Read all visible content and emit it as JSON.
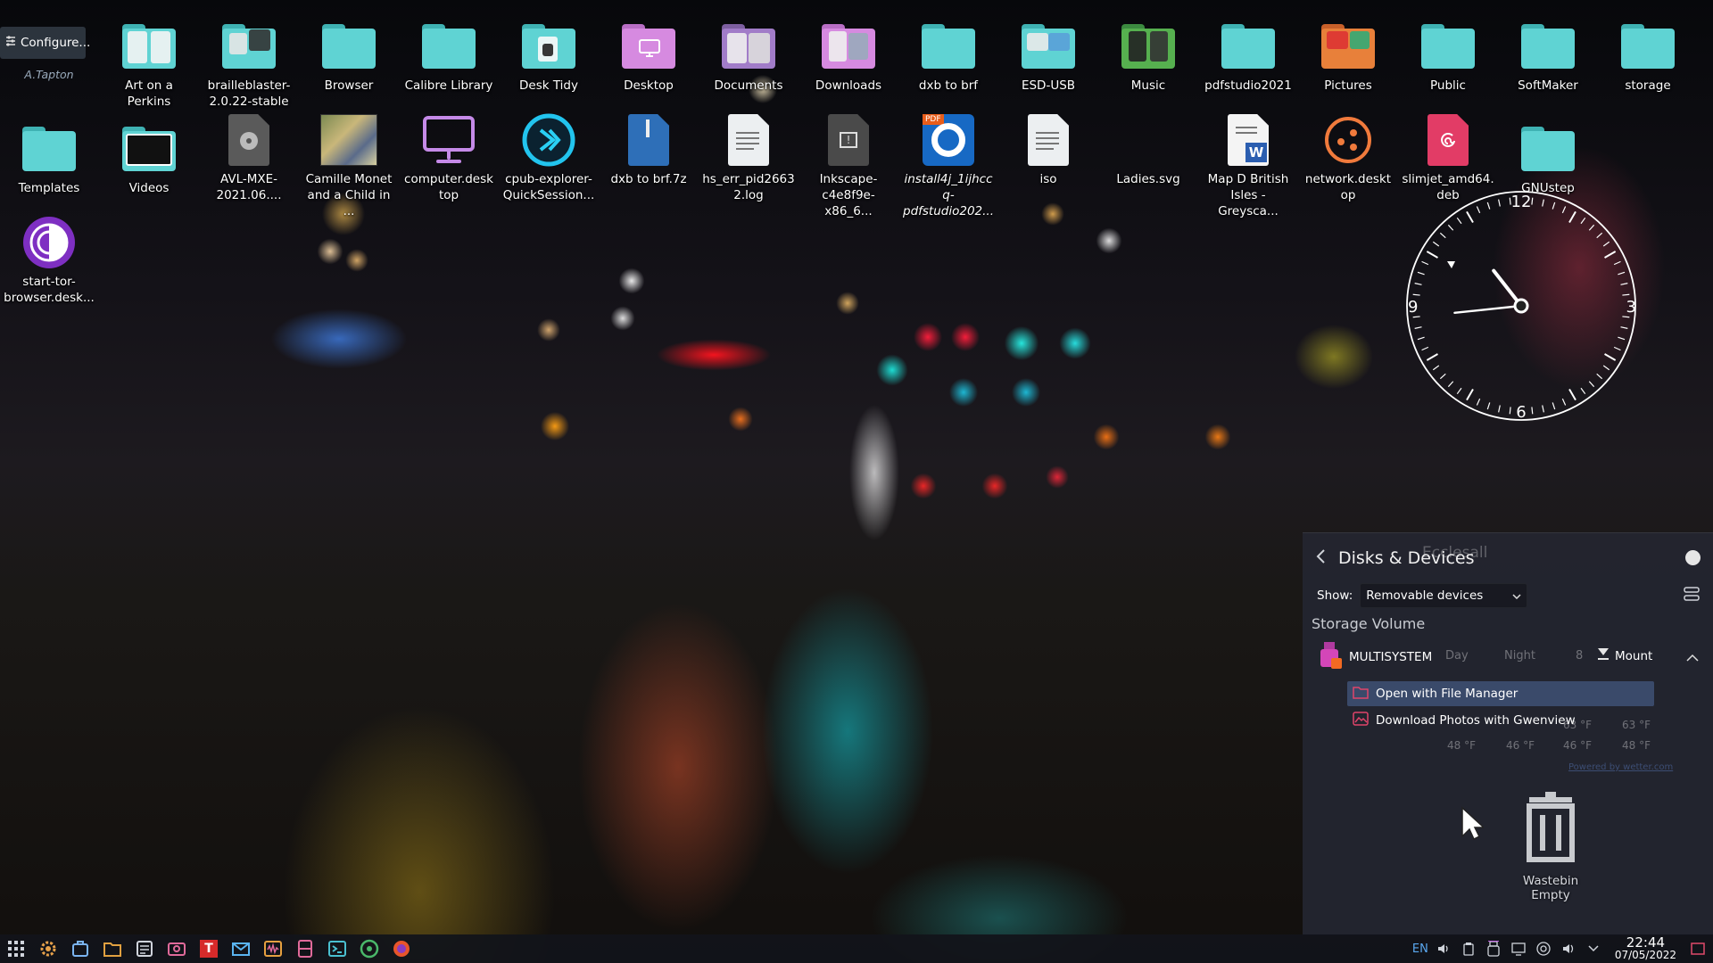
{
  "desktop": {
    "configure": {
      "label": "Configure...",
      "sub": "A.Tapton"
    },
    "icons": [
      {
        "label": "Art on a Perkins"
      },
      {
        "label": "brailleblaster-2.0.22-stable"
      },
      {
        "label": "Browser"
      },
      {
        "label": "Calibre Library"
      },
      {
        "label": "Desk Tidy"
      },
      {
        "label": "Desktop"
      },
      {
        "label": "Documents"
      },
      {
        "label": "Downloads"
      },
      {
        "label": "dxb to brf"
      },
      {
        "label": "ESD-USB"
      },
      {
        "label": "Music"
      },
      {
        "label": "pdfstudio2021"
      },
      {
        "label": "Pictures"
      },
      {
        "label": "Public"
      },
      {
        "label": "SoftMaker"
      },
      {
        "label": "storage"
      },
      {
        "label": "Templates"
      },
      {
        "label": "Videos"
      },
      {
        "label": "AVL-MXE-2021.06...."
      },
      {
        "label": "Camille Monet and a Child in ..."
      },
      {
        "label": "computer.desktop"
      },
      {
        "label": "cpub-explorer-QuickSession..."
      },
      {
        "label": "dxb to brf.7z"
      },
      {
        "label": "hs_err_pid26632.log"
      },
      {
        "label": "Inkscape-c4e8f9e-x86_6..."
      },
      {
        "label": "install4j_1ijhccq-pdfstudio202..."
      },
      {
        "label": "iso"
      },
      {
        "label": "Ladies.svg"
      },
      {
        "label": "Map D British Isles - Greysca..."
      },
      {
        "label": "network.desktop"
      },
      {
        "label": "slimjet_amd64.deb"
      },
      {
        "label": "GNUstep"
      },
      {
        "label": "start-tor-browser.desk..."
      }
    ]
  },
  "clock": {
    "numerals": [
      "12",
      "3",
      "6",
      "9"
    ],
    "time": "22:44"
  },
  "disks_panel": {
    "title": "Disks & Devices",
    "show_label": "Show:",
    "show_value": "Removable devices",
    "section": "Storage Volume",
    "device": {
      "name": "MULTISYSTEM",
      "action": "Mount"
    },
    "actions": [
      {
        "label": "Open with File Manager"
      },
      {
        "label": "Download Photos with Gwenview"
      }
    ],
    "weather_ghost": {
      "day": "Day",
      "night": "Night",
      "num": "8",
      "temps_high": [
        "63 °F",
        "63 °F"
      ],
      "temps_low": [
        "48 °F",
        "46 °F",
        "46 °F",
        "48 °F"
      ],
      "powered": "Powered by wetter.com",
      "top": "Ecclesall"
    }
  },
  "wastebin": {
    "label": "Wastebin",
    "status": "Empty"
  },
  "taskbar": {
    "lang": "EN",
    "time": "22:44",
    "date": "07/05/2022"
  },
  "colors": {
    "folder": "#5fd3d3",
    "folder_dark": "#3fb2b3",
    "desktop_folder": "#d68ae0",
    "accent": "#3daee9",
    "highlight_row": "#3a4a6a"
  }
}
